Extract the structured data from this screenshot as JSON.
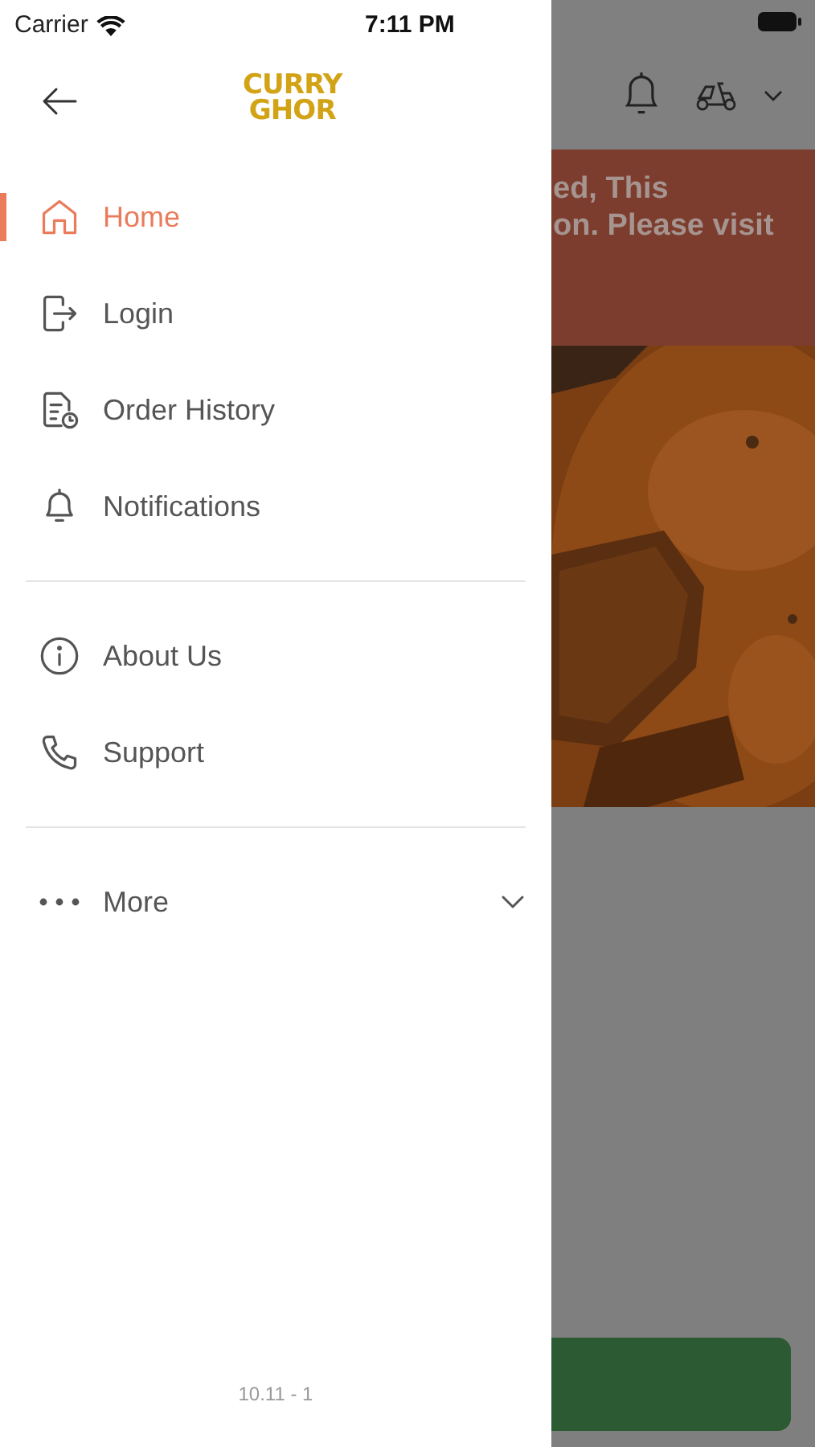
{
  "status_bar": {
    "carrier": "Carrier",
    "time": "7:11 PM"
  },
  "drawer": {
    "logo": [
      "CURRY",
      "GHOR"
    ],
    "sections": [
      [
        {
          "label": "Home",
          "selected": true
        },
        {
          "label": "Login",
          "selected": false
        },
        {
          "label": "Order History",
          "selected": false
        },
        {
          "label": "Notifications",
          "selected": false
        }
      ],
      [
        {
          "label": "About Us",
          "selected": false
        },
        {
          "label": "Support",
          "selected": false
        }
      ]
    ],
    "more": {
      "label": "More",
      "expanded": false
    },
    "version": "10.11 - 1"
  },
  "background_screen": {
    "banner_lines": [
      "ed, This",
      "on. Please visit"
    ]
  }
}
